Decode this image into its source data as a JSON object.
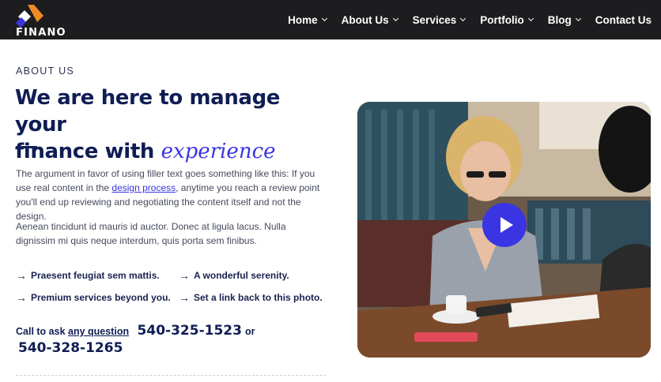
{
  "brand": {
    "name": "FINANO"
  },
  "nav": {
    "items": [
      {
        "label": "Home",
        "has_dropdown": true
      },
      {
        "label": "About Us",
        "has_dropdown": true
      },
      {
        "label": "Services",
        "has_dropdown": true
      },
      {
        "label": "Portfolio",
        "has_dropdown": true
      },
      {
        "label": "Blog",
        "has_dropdown": true
      },
      {
        "label": "Contact Us",
        "has_dropdown": false
      }
    ]
  },
  "about": {
    "eyebrow": "ABOUT US",
    "headline_line1": "We are here to manage your",
    "headline_line2_prefix": "finance with ",
    "headline_accent": "experience",
    "paragraph1_before_link": "The argument in favor of using filler text goes something like this: If you use real content in the ",
    "paragraph1_link": "design process",
    "paragraph1_after_link": ", anytime you reach a review point you'll end up reviewing and negotiating the content itself and not the design.",
    "paragraph2": "Aenean tincidunt id mauris id auctor. Donec at ligula lacus. Nulla dignissim mi quis neque interdum, quis porta sem finibus.",
    "features": [
      "Praesent feugiat sem mattis.",
      "A wonderful serenity.",
      "Premium services beyond you.",
      "Set a link back to this photo."
    ],
    "call": {
      "prefix": "Call to ask ",
      "link": "any question",
      "phone1": "540-325-1523",
      "or": "or",
      "phone2": "540-328-1265"
    }
  },
  "colors": {
    "header_bg": "#1d1d1f",
    "heading_navy": "#0f1d55",
    "accent_blue": "#3a35e3",
    "logo_orange": "#f08a24",
    "logo_blue": "#3a35e3"
  },
  "icons": {
    "feature_bullet": "arrow-right-icon",
    "nav_dropdown": "chevron-down-icon",
    "video": "play-icon"
  }
}
